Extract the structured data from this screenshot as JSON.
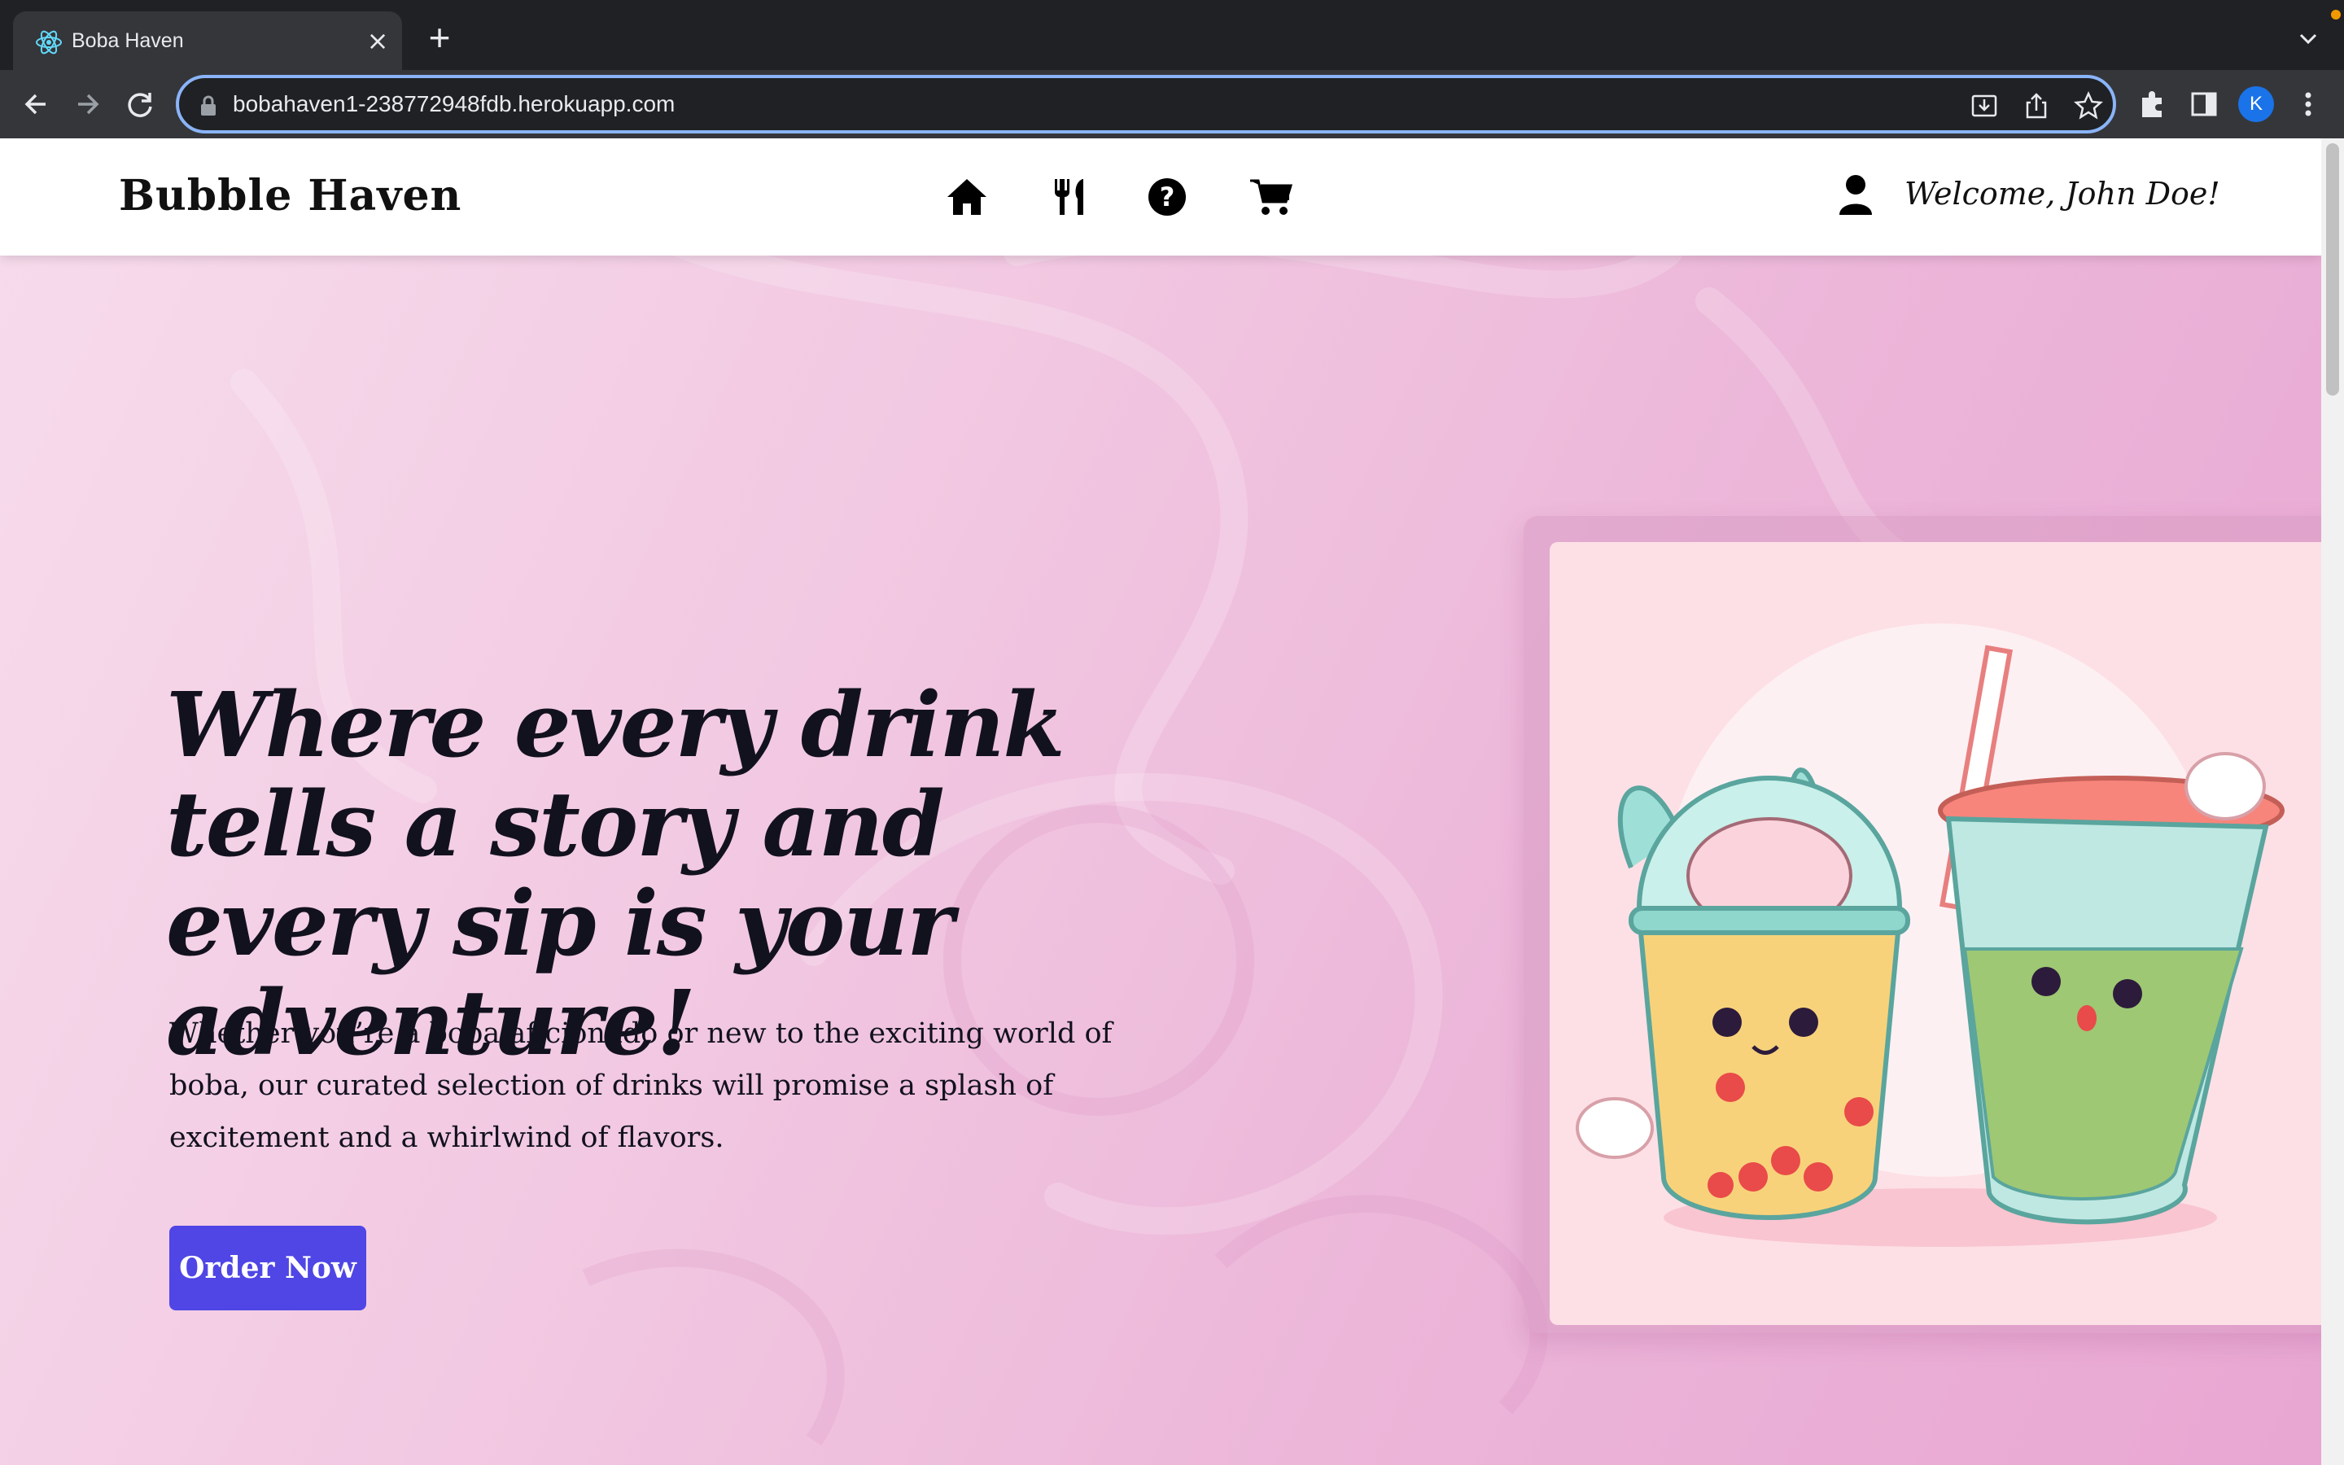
{
  "browser": {
    "tab_title": "Boba Haven",
    "url": "bobahaven1-238772948fdb.herokuapp.com",
    "avatar_letter": "K",
    "accent": "#8ab4f8"
  },
  "navbar": {
    "brand": "Bubble Haven",
    "icons": [
      "home-icon",
      "utensils-icon",
      "help-icon",
      "cart-icon"
    ],
    "welcome": "Welcome, John Doe!"
  },
  "hero": {
    "headline": "Where every drink tells a story and every sip is your adventure!",
    "subtext": "Whether you’re a boba aficionado or new to the exciting world of boba, our curated selection of drinks will promise a splash of excitement and a whirlwind of flavors.",
    "cta": "Order Now",
    "cta_color": "#4f46e5"
  }
}
